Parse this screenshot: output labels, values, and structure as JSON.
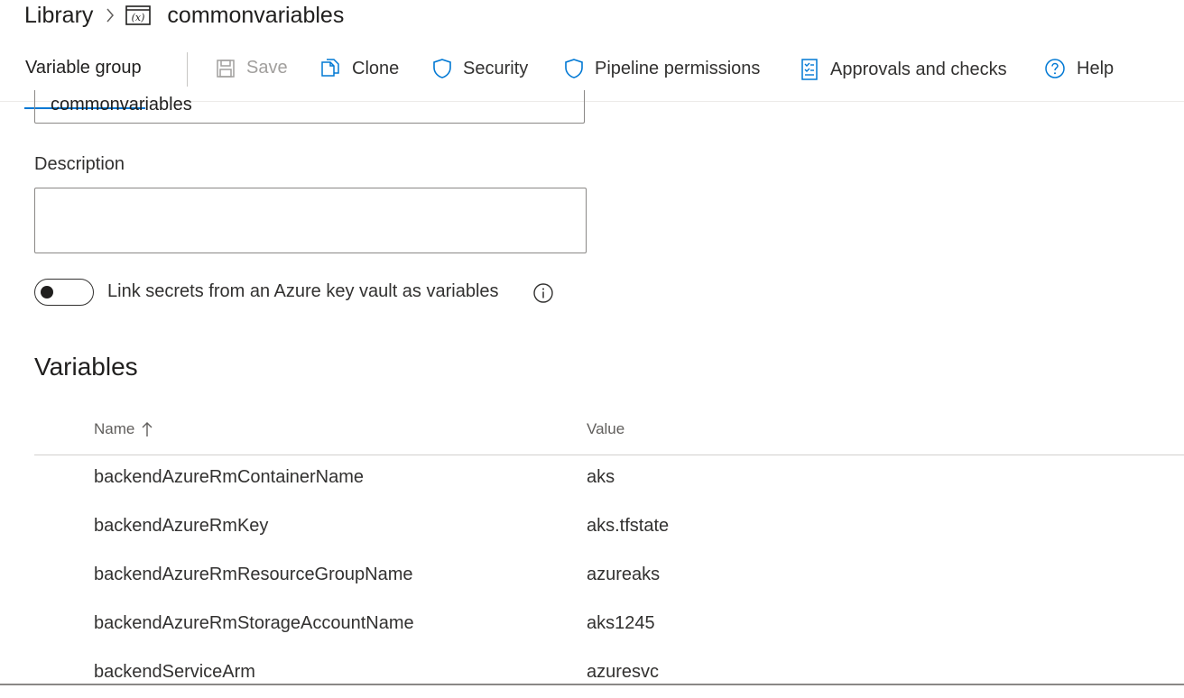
{
  "breadcrumb": {
    "library": "Library",
    "current": "commonvariables"
  },
  "toolbar": {
    "active_tab": "Variable group",
    "save": "Save",
    "clone": "Clone",
    "security": "Security",
    "pipeline_permissions": "Pipeline permissions",
    "approvals": "Approvals and checks",
    "help": "Help"
  },
  "form": {
    "name_value": "commonvariables",
    "description_label": "Description",
    "description_value": "",
    "keyvault_toggle_label": "Link secrets from an Azure key vault as variables",
    "keyvault_toggle_on": false
  },
  "variables": {
    "title": "Variables",
    "columns": {
      "name": "Name",
      "value": "Value"
    },
    "rows": [
      {
        "name": "backendAzureRmContainerName",
        "value": "aks"
      },
      {
        "name": "backendAzureRmKey",
        "value": "aks.tfstate"
      },
      {
        "name": "backendAzureRmResourceGroupName",
        "value": "azureaks"
      },
      {
        "name": "backendAzureRmStorageAccountName",
        "value": "aks1245"
      },
      {
        "name": "backendServiceArm",
        "value": "azuresvc"
      }
    ]
  },
  "colors": {
    "accent": "#0078d4",
    "text": "#323130",
    "muted": "#605e5c"
  }
}
